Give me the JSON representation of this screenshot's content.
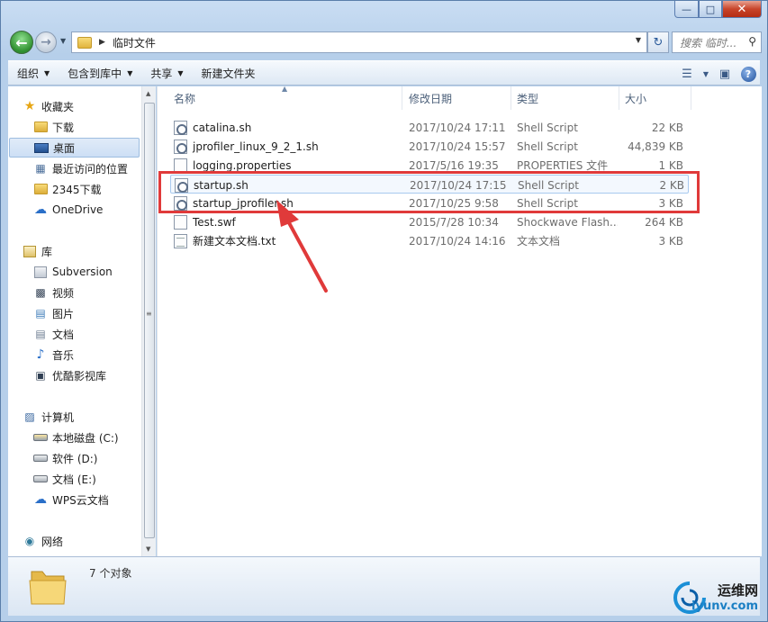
{
  "address": {
    "path_label": "临时文件",
    "search_placeholder": "搜索 临时...",
    "back_icon": "back-arrow-icon",
    "forward_icon": "forward-arrow-icon"
  },
  "toolbar": {
    "organize": "组织",
    "include_in_library": "包含到库中",
    "share": "共享",
    "new_folder": "新建文件夹"
  },
  "sidebar": {
    "items": [
      {
        "label": "收藏夹",
        "icon": "star-icon"
      },
      {
        "label": "下载",
        "icon": "downloads-folder-icon"
      },
      {
        "label": "桌面",
        "icon": "desktop-icon"
      },
      {
        "label": "最近访问的位置",
        "icon": "recent-places-icon"
      },
      {
        "label": "2345下载",
        "icon": "folder-icon"
      },
      {
        "label": "OneDrive",
        "icon": "cloud-icon"
      },
      {
        "label": "库",
        "icon": "library-icon"
      },
      {
        "label": "Subversion",
        "icon": "library-icon"
      },
      {
        "label": "视频",
        "icon": "video-icon"
      },
      {
        "label": "图片",
        "icon": "picture-icon"
      },
      {
        "label": "文档",
        "icon": "document-icon"
      },
      {
        "label": "音乐",
        "icon": "music-icon"
      },
      {
        "label": "优酷影视库",
        "icon": "library-icon"
      },
      {
        "label": "计算机",
        "icon": "computer-icon"
      },
      {
        "label": "本地磁盘 (C:)",
        "icon": "system-drive-icon"
      },
      {
        "label": "软件 (D:)",
        "icon": "drive-icon"
      },
      {
        "label": "文档 (E:)",
        "icon": "drive-icon"
      },
      {
        "label": "WPS云文档",
        "icon": "cloud-icon"
      },
      {
        "label": "网络",
        "icon": "network-icon"
      }
    ]
  },
  "columns": {
    "name": "名称",
    "date": "修改日期",
    "type": "类型",
    "size": "大小"
  },
  "files": [
    {
      "name": "catalina.sh",
      "date": "2017/10/24 17:11",
      "type": "Shell Script",
      "size": "22 KB",
      "icon": "script-file-icon"
    },
    {
      "name": "jprofiler_linux_9_2_1.sh",
      "date": "2017/10/24 15:57",
      "type": "Shell Script",
      "size": "44,839 KB",
      "icon": "script-file-icon"
    },
    {
      "name": "logging.properties",
      "date": "2017/5/16 19:35",
      "type": "PROPERTIES 文件",
      "size": "1 KB",
      "icon": "blank-file-icon"
    },
    {
      "name": "startup.sh",
      "date": "2017/10/24 17:15",
      "type": "Shell Script",
      "size": "2 KB",
      "icon": "script-file-icon"
    },
    {
      "name": "startup_jprofiler.sh",
      "date": "2017/10/25 9:58",
      "type": "Shell Script",
      "size": "3 KB",
      "icon": "script-file-icon"
    },
    {
      "name": "Test.swf",
      "date": "2015/7/28 10:34",
      "type": "Shockwave Flash...",
      "size": "264 KB",
      "icon": "blank-file-icon"
    },
    {
      "name": "新建文本文档.txt",
      "date": "2017/10/24 14:16",
      "type": "文本文档",
      "size": "3 KB",
      "icon": "text-file-icon"
    }
  ],
  "status": {
    "count_text": "7 个对象"
  },
  "watermark": {
    "line1": "运维网",
    "line2": "iyunv.com"
  },
  "colors": {
    "highlight": "#e03a3a",
    "accent": "#2a6fc8"
  }
}
